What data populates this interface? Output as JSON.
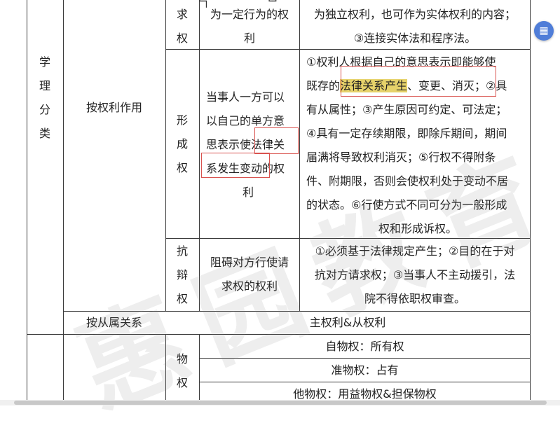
{
  "top_fragment": "└┐　　　　　└┘",
  "rows": {
    "req_right": {
      "col3_chars": [
        "求",
        "权"
      ],
      "col4_lines": [
        "为一定行为的权",
        "利"
      ],
      "col5_lines": [
        "为独立权利，也可作为实体权利的内容；",
        "③连接实体法和程序法。"
      ]
    },
    "left_category_chars": [
      "学",
      "理",
      "分",
      "类"
    ],
    "by_function_label": "按权利作用",
    "formation": {
      "col3_chars": [
        "形",
        "成",
        "权"
      ],
      "col4_lines": [
        "当事人一方可以",
        "以自己的单方意",
        "思表示使法律关",
        "系发生变动的权",
        "利"
      ],
      "col5_lines": [
        "①权利人根据自己的意思表示即能够使",
        "既存的法律关系产生、变更、消灭；②具",
        "有从属性；③产生原因可约定、可法定；",
        "④具有一定存续期限，即除斥期间，期间",
        "届满将导致权利消灭；⑤行权不得附条",
        "件、附期限，否则会使权利处于变动不居",
        "的状态。⑥行使方式不同可分为一般形成",
        "权和形成诉权。"
      ],
      "highlight_text": "法律关系产生"
    },
    "defense": {
      "col3_chars": [
        "抗",
        "辩",
        "权"
      ],
      "col4_lines": [
        "阻碍对方行使请",
        "求权的权利"
      ],
      "col5_lines": [
        "①必须基于法律规定产生；②目的在于对",
        "抗对方请求权；③当事人不主动援引，法",
        "院不得依职权审查。"
      ]
    },
    "by_subordination": {
      "label": "按从属关系",
      "value": "主权利&从权利"
    },
    "property": {
      "col3_chars": [
        "物",
        "权"
      ],
      "items": [
        "自物权：所有权",
        "准物权：占有",
        "他物权：用益物权&担保物权"
      ]
    }
  },
  "watermark_text": "惠园教育",
  "float_icon": "document-icon",
  "colors": {
    "highlight": "#e6d26a",
    "box": "#d9534f",
    "float": "#4f7dd8"
  }
}
